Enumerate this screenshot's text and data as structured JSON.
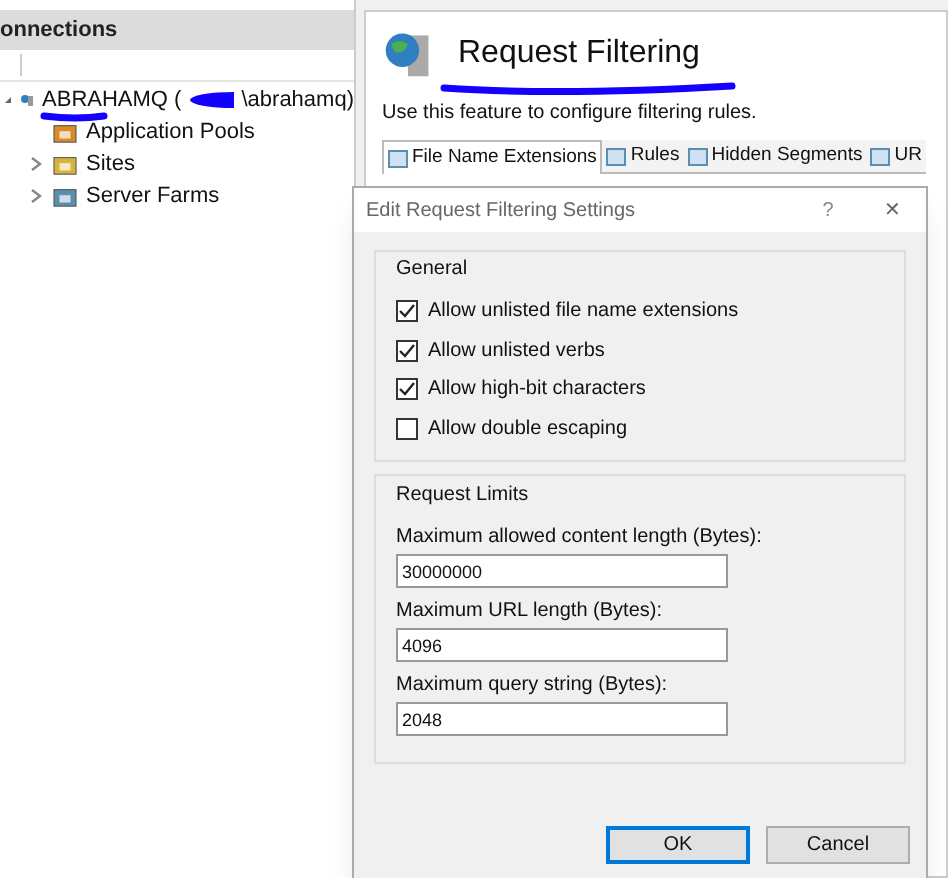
{
  "connections": {
    "title": "onnections",
    "tree": [
      {
        "label": "ABRAHAMQ (",
        "label_end": "\\abrahamq)",
        "expanded": true,
        "children": [
          {
            "label": "Application Pools"
          },
          {
            "label": "Sites",
            "expanded": false
          },
          {
            "label": "Server Farms",
            "expanded": false
          }
        ]
      }
    ]
  },
  "feature": {
    "title": "Request Filtering",
    "description": "Use this feature to configure filtering rules.",
    "tabs": [
      {
        "label": "File Name Extensions",
        "selected": true
      },
      {
        "label": "Rules",
        "selected": false
      },
      {
        "label": "Hidden Segments",
        "selected": false
      },
      {
        "label": "UR",
        "selected": false
      }
    ]
  },
  "dialog": {
    "title": "Edit Request Filtering Settings",
    "help": "?",
    "close": "✕",
    "general": {
      "title": "General",
      "options": [
        {
          "label": "Allow unlisted file name extensions",
          "checked": true
        },
        {
          "label": "Allow unlisted verbs",
          "checked": true
        },
        {
          "label": "Allow high-bit characters",
          "checked": true
        },
        {
          "label": "Allow double escaping",
          "checked": false
        }
      ]
    },
    "limits": {
      "title": "Request Limits",
      "fields": [
        {
          "label": "Maximum allowed content length (Bytes):",
          "value": "30000000"
        },
        {
          "label": "Maximum URL length (Bytes):",
          "value": "4096"
        },
        {
          "label": "Maximum query string (Bytes):",
          "value": "2048"
        }
      ]
    },
    "buttons": [
      {
        "label": "OK",
        "selected": true
      },
      {
        "label": "Cancel",
        "selected": false
      }
    ]
  }
}
